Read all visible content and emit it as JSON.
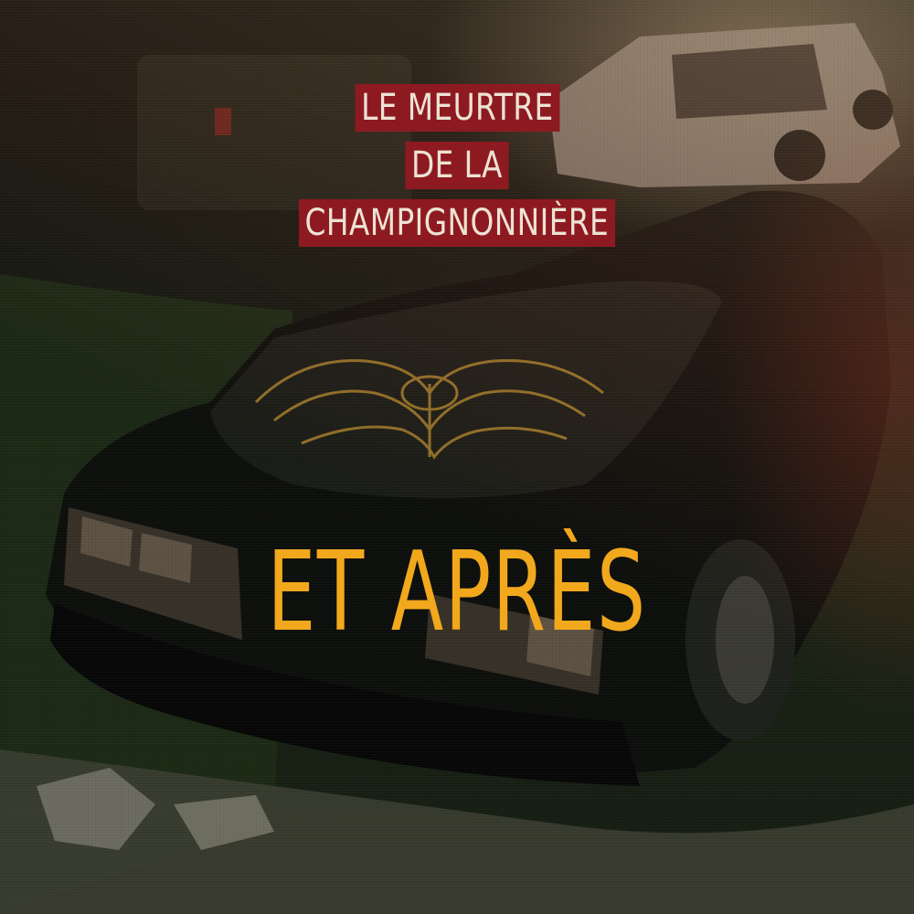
{
  "cover": {
    "title_lines": [
      "LE MEURTRE",
      "DE LA",
      "CHAMPIGNONNIÈRE"
    ],
    "subtitle": "ET APRÈS"
  },
  "colors": {
    "title_band": "#8e1a21",
    "title_text": "#ece3d4",
    "subtitle_text": "#f2a81d",
    "hood_emblem": "#b58a2e"
  }
}
